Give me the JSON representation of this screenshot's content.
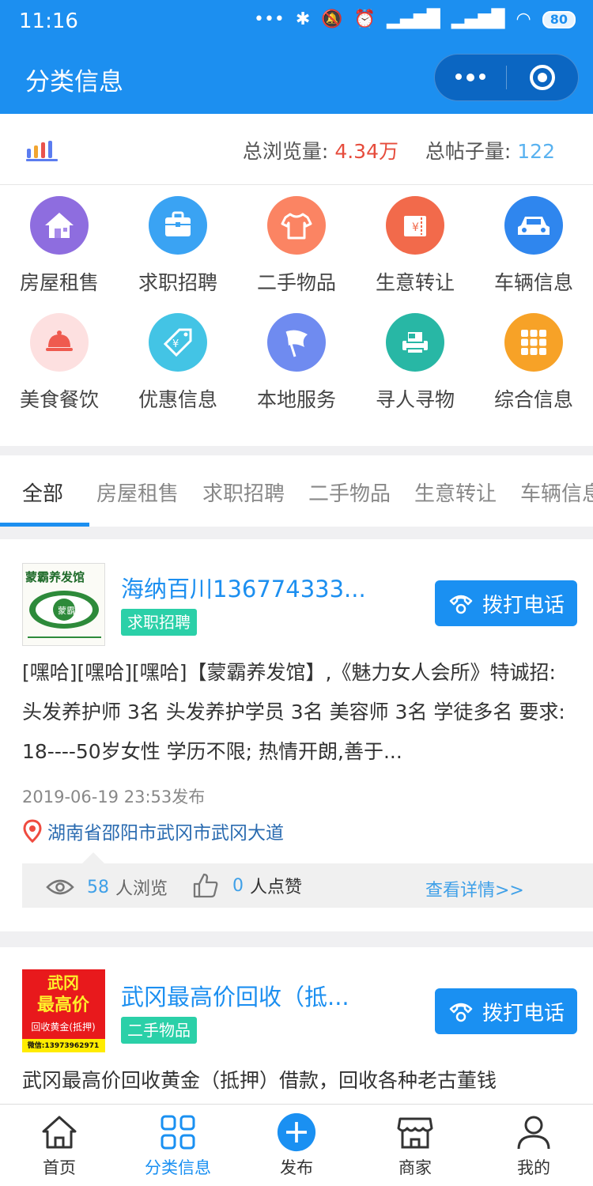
{
  "status_bar": {
    "time": "11:16",
    "battery": "80"
  },
  "nav": {
    "title": "分类信息"
  },
  "stats": {
    "views_label": "总浏览量:",
    "views_value": "4.34万",
    "posts_label": "总帖子量:",
    "posts_value": "122"
  },
  "categories": [
    {
      "label": "房屋租售",
      "color": "#8e6ddf",
      "icon": "house-icon"
    },
    {
      "label": "求职招聘",
      "color": "#3aa3f3",
      "icon": "briefcase-icon"
    },
    {
      "label": "二手物品",
      "color": "#fb8463",
      "icon": "tshirt-icon"
    },
    {
      "label": "生意转让",
      "color": "#f26a4b",
      "icon": "ticket-icon"
    },
    {
      "label": "车辆信息",
      "color": "#2f86ee",
      "icon": "car-icon"
    },
    {
      "label": "美食餐饮",
      "color": "#fde0e0",
      "icon": "food-cloche-icon"
    },
    {
      "label": "优惠信息",
      "color": "#43c4e5",
      "icon": "price-tag-icon"
    },
    {
      "label": "本地服务",
      "color": "#6f8bf0",
      "icon": "flag-icon"
    },
    {
      "label": "寻人寻物",
      "color": "#28b7a5",
      "icon": "printer-icon"
    },
    {
      "label": "综合信息",
      "color": "#f7a227",
      "icon": "grid-icon"
    }
  ],
  "tabs": [
    "全部",
    "房屋租售",
    "求职招聘",
    "二手物品",
    "生意转让",
    "车辆信息"
  ],
  "posts": [
    {
      "title": "海纳百川136774333...",
      "tag": "求职招聘",
      "thumb_title": "蒙霸养发馆",
      "thumb_logo": "蒙霸",
      "call_label": "拨打电话",
      "body": "[嘿哈][嘿哈][嘿哈]【蒙霸养发馆】,《魅力女人会所》特诚招: 头发养护师 3名 头发养护学员 3名 美容师 3名 学徒多名 要求: 18----50岁女性 学历不限; 热情开朗,善于...",
      "date": "2019-06-19 23:53发布",
      "location": "湖南省邵阳市武冈市武冈大道",
      "views": "58",
      "views_suffix": "人浏览",
      "likes": "0",
      "likes_suffix": "人点赞",
      "detail": "查看详情>>"
    },
    {
      "title": "武冈最高价回收（抵...",
      "tag": "二手物品",
      "thumb_line1": "武冈",
      "thumb_line2": "最高价",
      "thumb_line3": "回收黄金(抵押)",
      "thumb_line4": "微信:13973962971",
      "call_label": "拨打电话",
      "body": "武冈最高价回收黄金（抵押）借款，回收各种老古董钱"
    }
  ],
  "tabbar": [
    {
      "label": "首页",
      "icon": "home-icon"
    },
    {
      "label": "分类信息",
      "icon": "category-grid-icon",
      "active": true
    },
    {
      "label": "发布",
      "icon": "plus-circle-icon"
    },
    {
      "label": "商家",
      "icon": "shop-icon"
    },
    {
      "label": "我的",
      "icon": "user-icon"
    }
  ]
}
